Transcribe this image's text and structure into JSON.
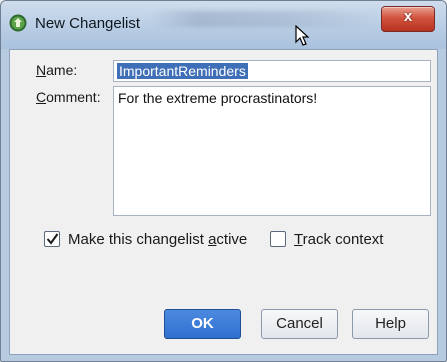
{
  "window": {
    "title": "New Changelist",
    "close_label": "x",
    "colors": {
      "accent": "#2f6fce",
      "close": "#c8412d",
      "selection": "#3f6fb6"
    }
  },
  "form": {
    "name_label_mnemonic": "N",
    "name_label_rest": "ame:",
    "name_value": "ImportantReminders",
    "comment_label_mnemonic": "C",
    "comment_label_rest": "omment:",
    "comment_value": "For the extreme procrastinators!"
  },
  "options": {
    "make_active_prefix": "Make this changelist ",
    "make_active_mnemonic": "a",
    "make_active_suffix": "ctive",
    "make_active_checked": true,
    "track_context_mnemonic": "T",
    "track_context_rest": "rack context",
    "track_context_checked": false
  },
  "buttons": {
    "ok": "OK",
    "cancel": "Cancel",
    "help": "Help"
  },
  "icons": {
    "app": "intellij-changelist-icon",
    "cursor": "mouse-pointer-icon",
    "check": "checkmark-icon"
  }
}
